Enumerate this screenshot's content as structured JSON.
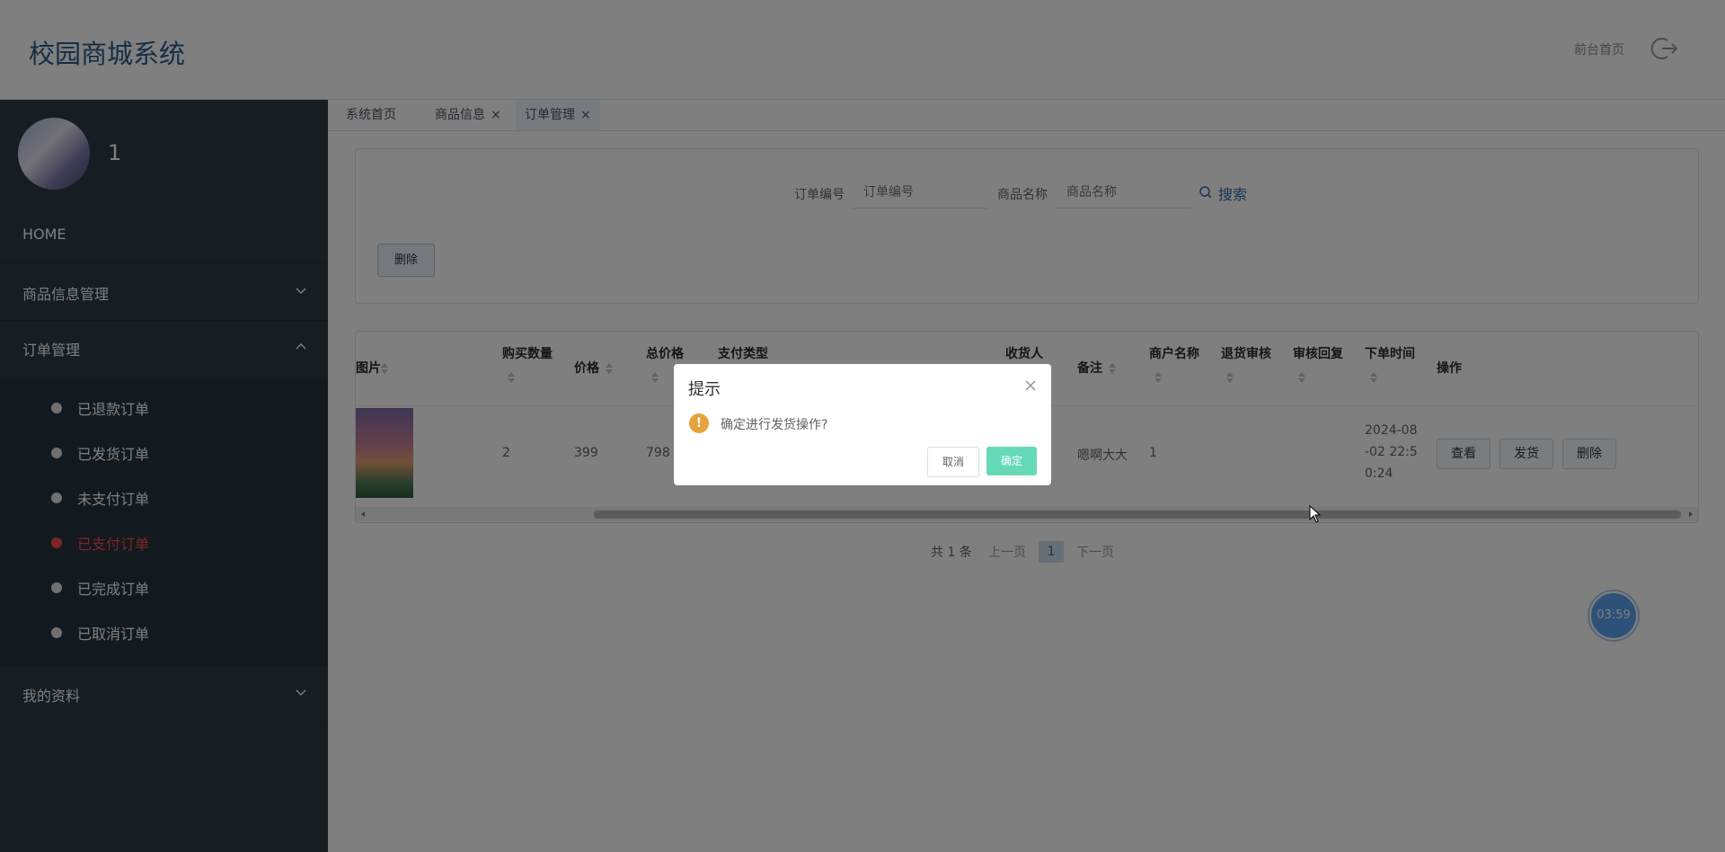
{
  "header": {
    "title": "校园商城系统",
    "front_link": "前台首页"
  },
  "sidebar": {
    "username": "1",
    "items": [
      {
        "label": "HOME"
      },
      {
        "label": "商品信息管理"
      },
      {
        "label": "订单管理"
      },
      {
        "label": "我的资料"
      }
    ],
    "order_submenu": [
      {
        "label": "已退款订单"
      },
      {
        "label": "已发货订单"
      },
      {
        "label": "未支付订单"
      },
      {
        "label": "已支付订单",
        "active": true
      },
      {
        "label": "已完成订单"
      },
      {
        "label": "已取消订单"
      }
    ]
  },
  "tabs": [
    {
      "label": "系统首页"
    },
    {
      "label": "商品信息",
      "close": "×"
    },
    {
      "label": "订单管理",
      "close": "×",
      "active": true
    }
  ],
  "search": {
    "order_no_label": "订单编号",
    "order_no_placeholder": "订单编号",
    "product_name_label": "商品名称",
    "product_name_placeholder": "商品名称",
    "search_button": "搜索",
    "delete_button": "删除"
  },
  "table": {
    "headers": {
      "image": "图片",
      "quantity": "购买数量",
      "price": "价格",
      "total": "总价格",
      "pay_type": "支付类型",
      "receiver": "收货人",
      "remark": "备注",
      "merchant": "商户名称",
      "refund_review": "退货审核",
      "review_reply": "审核回复",
      "order_time": "下单时间",
      "actions": "操作"
    },
    "row": {
      "quantity": "2",
      "price": "399",
      "total": "798",
      "remark": "嗯啊大大",
      "merchant": "1",
      "order_time_1": "2024-08",
      "order_time_2": "-02 22:5",
      "order_time_3": "0:24",
      "view": "查看",
      "ship": "发货",
      "delete": "删除"
    }
  },
  "pagination": {
    "total": "共 1 条",
    "prev": "上一页",
    "page": "1",
    "next": "下一页"
  },
  "timer": "03:59",
  "dialog": {
    "title": "提示",
    "warn_glyph": "!",
    "message": "确定进行发货操作?",
    "cancel": "取消",
    "confirm": "确定"
  },
  "colors": {
    "sidebar_bg": "#2c3b47",
    "active_menu": "#ff4949",
    "confirm_button": "#66dab8",
    "warning": "#e6a23c"
  },
  "icons": [
    "logout-icon",
    "chevron-down-icon",
    "chevron-up-icon",
    "search-icon",
    "sort-icon",
    "close-icon",
    "warning-icon"
  ]
}
